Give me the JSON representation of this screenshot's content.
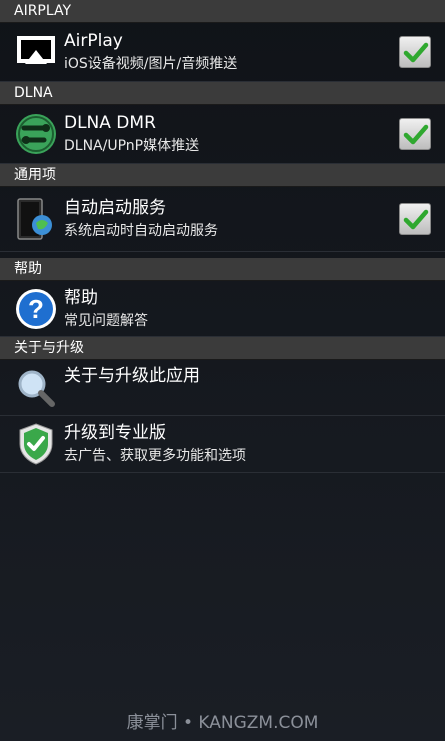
{
  "sections": {
    "airplay": {
      "header": "AIRPLAY",
      "item": {
        "title": "AirPlay",
        "subtitle": "iOS设备视频/图片/音频推送",
        "icon": "airplay-icon",
        "checked": true
      }
    },
    "dlna": {
      "header": "DLNA",
      "item": {
        "title": "DLNA DMR",
        "subtitle": "DLNA/UPnP媒体推送",
        "icon": "dlna-icon",
        "checked": true
      }
    },
    "general": {
      "header": "通用项",
      "item": {
        "title": "自动启动服务",
        "subtitle": "系统启动时自动启动服务",
        "icon": "autostart-icon",
        "checked": true
      }
    },
    "help": {
      "header": "帮助",
      "item": {
        "title": "帮助",
        "subtitle": "常见问题解答",
        "icon": "question-icon"
      }
    },
    "about": {
      "header": "关于与升级",
      "items": [
        {
          "title": "关于与升级此应用",
          "subtitle": "",
          "icon": "magnifier-icon"
        },
        {
          "title": "升级到专业版",
          "subtitle": "去广告、获取更多功能和选项",
          "icon": "shield-icon"
        }
      ]
    }
  },
  "footer": {
    "watermark": "康掌门 • KANGZM.COM"
  },
  "colors": {
    "header_bg": "#3b3b3b",
    "check_green": "#2fa82f",
    "background": "#14171c"
  }
}
